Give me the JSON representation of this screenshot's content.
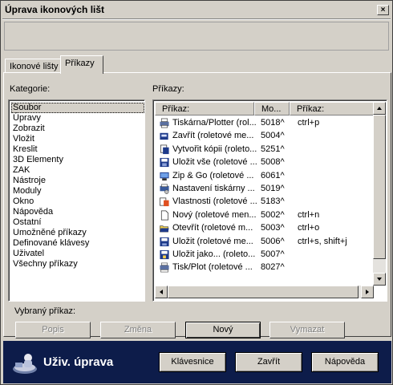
{
  "window": {
    "title": "Úprava ikonových lišt",
    "close_glyph": "×"
  },
  "tabs": [
    {
      "label": "Ikonové lišty",
      "active": false
    },
    {
      "label": "Příkazy",
      "active": true
    }
  ],
  "categories": {
    "label": "Kategorie:",
    "items": [
      "Soubor",
      "Úpravy",
      "Zobrazit",
      "Vložit",
      "Kreslit",
      "3D Elementy",
      "ZAK",
      "Nástroje",
      "Moduly",
      "Okno",
      "Nápověda",
      "Ostatní",
      "Umožněné příkazy",
      "Definované klávesy",
      "Uživatel",
      "Všechny příkazy"
    ],
    "selected": "Soubor"
  },
  "commands": {
    "label": "Příkazy:",
    "columns": [
      "Příkaz:",
      "Mo...",
      "Příkaz:"
    ],
    "rows": [
      {
        "icon": "printer-icon",
        "name": "Tiskárna/Plotter (rol...",
        "code": "5018^",
        "shortcut": "ctrl+p"
      },
      {
        "icon": "close-file-icon",
        "name": "Zavřít (roletové me...",
        "code": "5004^",
        "shortcut": ""
      },
      {
        "icon": "copy-icon",
        "name": "Vytvořit kópii (roleto...",
        "code": "5251^",
        "shortcut": ""
      },
      {
        "icon": "save-all-icon",
        "name": "Uložit vše (roletové ...",
        "code": "5008^",
        "shortcut": ""
      },
      {
        "icon": "zip-icon",
        "name": "Zip & Go (roletové ...",
        "code": "6061^",
        "shortcut": ""
      },
      {
        "icon": "printer-setup-icon",
        "name": "Nastavení tiskárny ...",
        "code": "5019^",
        "shortcut": ""
      },
      {
        "icon": "properties-icon",
        "name": "Vlastnosti (roletové ...",
        "code": "5183^",
        "shortcut": ""
      },
      {
        "icon": "new-file-icon",
        "name": "Nový (roletové men...",
        "code": "5002^",
        "shortcut": "ctrl+n"
      },
      {
        "icon": "open-folder-icon",
        "name": "Otevřít (roletové m...",
        "code": "5003^",
        "shortcut": "ctrl+o"
      },
      {
        "icon": "save-icon",
        "name": "Uložit (roletové me...",
        "code": "5006^",
        "shortcut": "ctrl+s, shift+j"
      },
      {
        "icon": "save-as-icon",
        "name": "Uložit jako... (roleto...",
        "code": "5007^",
        "shortcut": ""
      },
      {
        "icon": "plot-icon",
        "name": "Tisk/Plot (roletové ...",
        "code": "8027^",
        "shortcut": ""
      }
    ]
  },
  "selected_command_label": "Vybraný příkaz:",
  "actions": {
    "popis": "Popis",
    "zmena": "Změna",
    "novy": "Nový",
    "vymazat": "Vymazat"
  },
  "footer": {
    "title": "Uživ. úprava",
    "klavesnice": "Klávesnice",
    "zavrit": "Zavřít",
    "napoveda": "Nápověda"
  },
  "colors": {
    "footer_bg": "#0d1c4a",
    "face": "#d4d0c8"
  }
}
